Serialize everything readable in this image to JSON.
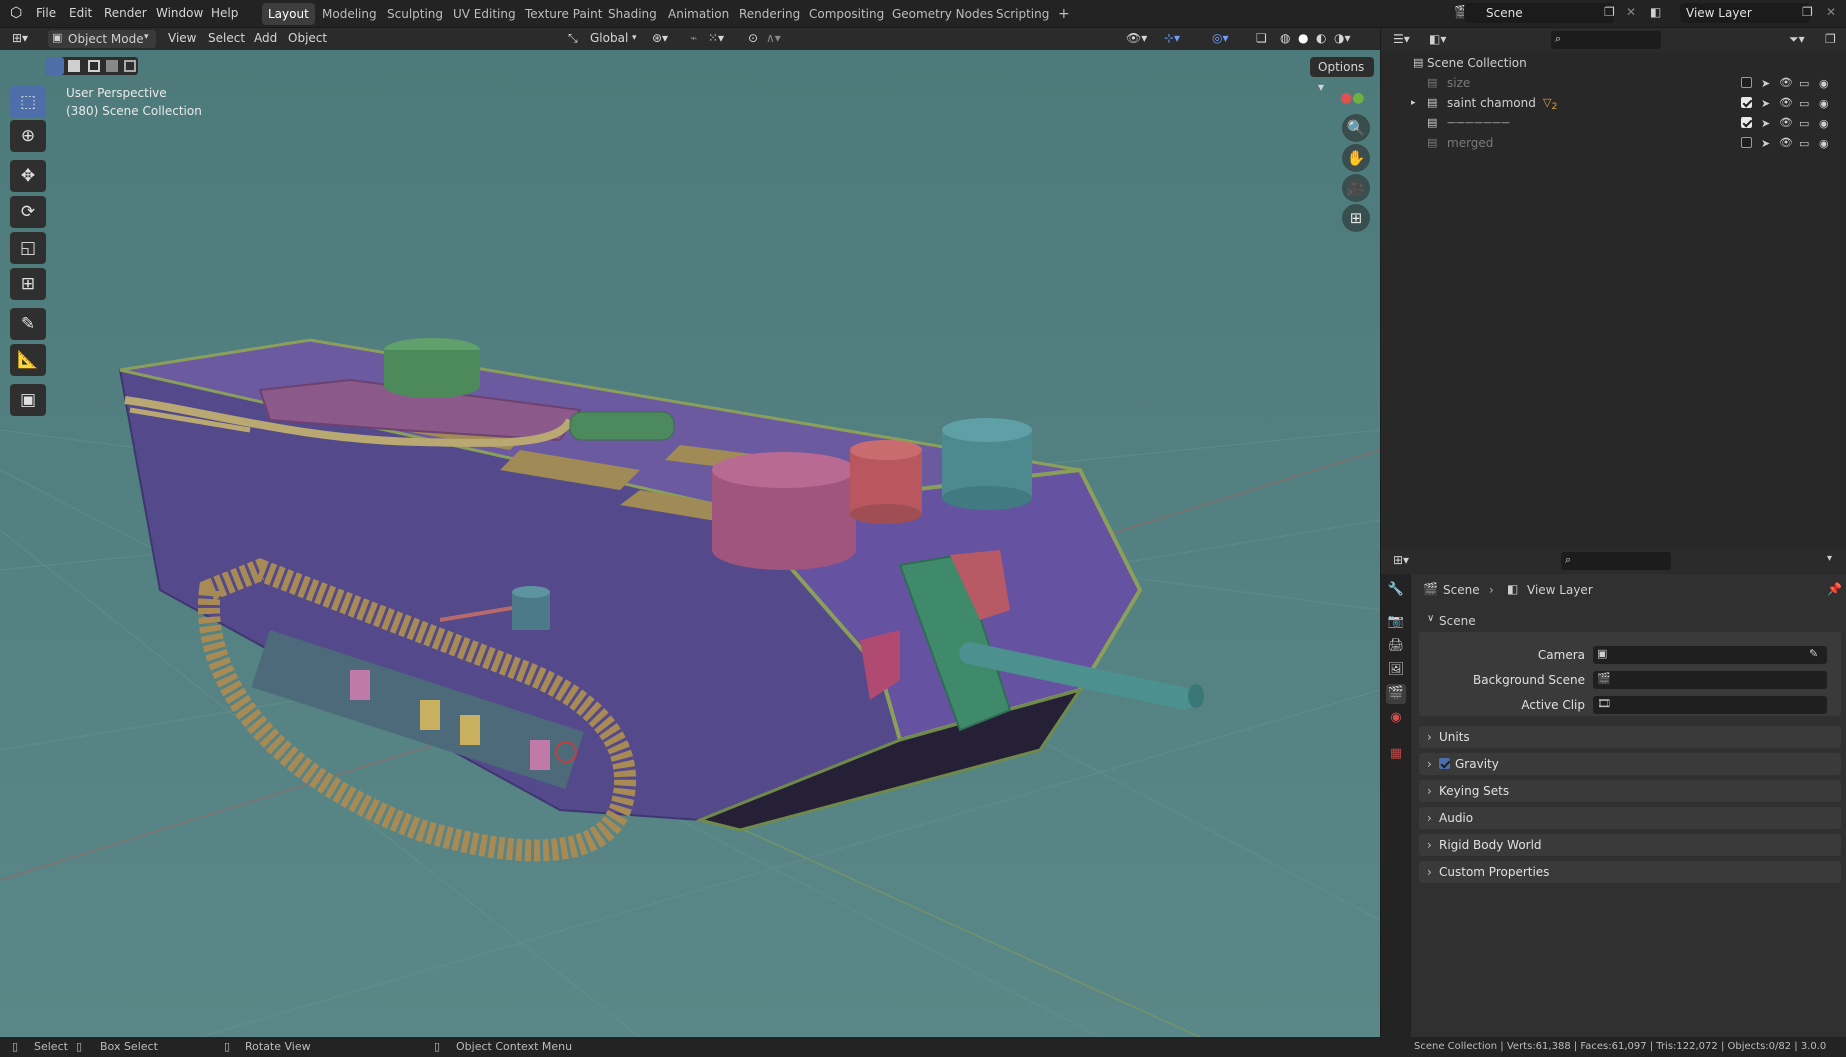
{
  "topbar": {
    "menus": [
      "File",
      "Edit",
      "Render",
      "Window",
      "Help"
    ],
    "workspaces": [
      "Layout",
      "Modeling",
      "Sculpting",
      "UV Editing",
      "Texture Paint",
      "Shading",
      "Animation",
      "Rendering",
      "Compositing",
      "Geometry Nodes",
      "Scripting"
    ],
    "active_workspace": "Layout",
    "add_tab": "+",
    "scene_name": "Scene",
    "view_layer": "View Layer"
  },
  "viewport_header": {
    "mode": "Object Mode",
    "menus": [
      "View",
      "Select",
      "Add",
      "Object"
    ],
    "orientation": "Global",
    "options": "Options"
  },
  "viewport": {
    "perspective": "User Perspective",
    "collection": "(380) Scene Collection"
  },
  "outliner": {
    "root": "Scene Collection",
    "rows": [
      {
        "label": "size",
        "checked": false,
        "dim": true
      },
      {
        "label": "saint chamond",
        "checked": true,
        "dim": false,
        "badge": "2"
      },
      {
        "label": "———————",
        "checked": true,
        "dim": false
      },
      {
        "label": "merged",
        "checked": false,
        "dim": true
      }
    ]
  },
  "properties": {
    "breadcrumb_scene": "Scene",
    "breadcrumb_sep": "›",
    "breadcrumb_layer": "View Layer",
    "section_scene": "Scene",
    "fields": [
      {
        "label": "Camera"
      },
      {
        "label": "Background Scene"
      },
      {
        "label": "Active Clip"
      }
    ],
    "panels": [
      "Units",
      "Gravity",
      "Keying Sets",
      "Audio",
      "Rigid Body World",
      "Custom Properties"
    ],
    "gravity_checked": true
  },
  "statusbar": {
    "select": "Select",
    "box_select": "Box Select",
    "rotate": "Rotate View",
    "context": "Object Context Menu",
    "stats": "Scene Collection | Verts:61,388 | Faces:61,097 | Tris:122,072 | Objects:0/82 | 3.0.0"
  },
  "colors": {
    "accent": "#4d6ea8",
    "viewport_bg": "#527f80",
    "hull": "#5a4f8f",
    "trim": "#8aa05a"
  }
}
